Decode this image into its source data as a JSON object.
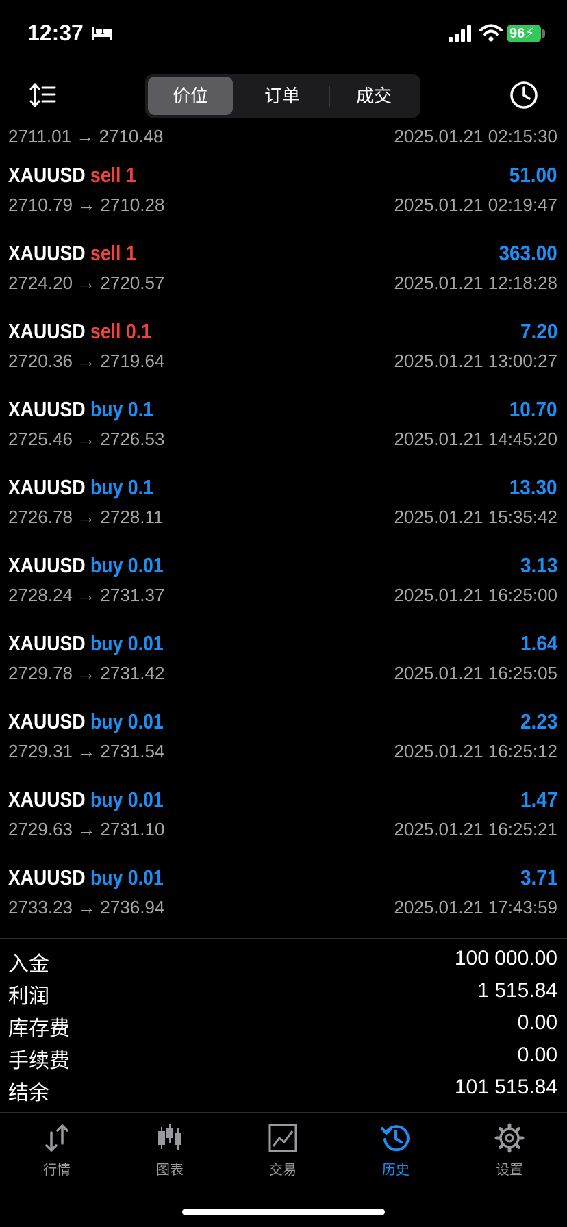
{
  "status_bar": {
    "time": "12:37",
    "battery": "96"
  },
  "toolbar": {
    "segments": [
      "价位",
      "订单",
      "成交"
    ],
    "active_segment": "价位"
  },
  "partial_row": {
    "prices": "2711.01 → 2710.48",
    "time": "2025.01.21 02:15:30"
  },
  "deals": [
    {
      "symbol": "XAUUSD",
      "side": "sell 1",
      "type": "sell",
      "amount": "51.00",
      "prices": "2710.79 → 2710.28",
      "time": "2025.01.21 02:19:47"
    },
    {
      "symbol": "XAUUSD",
      "side": "sell 1",
      "type": "sell",
      "amount": "363.00",
      "prices": "2724.20 → 2720.57",
      "time": "2025.01.21 12:18:28"
    },
    {
      "symbol": "XAUUSD",
      "side": "sell 0.1",
      "type": "sell",
      "amount": "7.20",
      "prices": "2720.36 → 2719.64",
      "time": "2025.01.21 13:00:27"
    },
    {
      "symbol": "XAUUSD",
      "side": "buy 0.1",
      "type": "buy",
      "amount": "10.70",
      "prices": "2725.46 → 2726.53",
      "time": "2025.01.21 14:45:20"
    },
    {
      "symbol": "XAUUSD",
      "side": "buy 0.1",
      "type": "buy",
      "amount": "13.30",
      "prices": "2726.78 → 2728.11",
      "time": "2025.01.21 15:35:42"
    },
    {
      "symbol": "XAUUSD",
      "side": "buy 0.01",
      "type": "buy",
      "amount": "3.13",
      "prices": "2728.24 → 2731.37",
      "time": "2025.01.21 16:25:00"
    },
    {
      "symbol": "XAUUSD",
      "side": "buy 0.01",
      "type": "buy",
      "amount": "1.64",
      "prices": "2729.78 → 2731.42",
      "time": "2025.01.21 16:25:05"
    },
    {
      "symbol": "XAUUSD",
      "side": "buy 0.01",
      "type": "buy",
      "amount": "2.23",
      "prices": "2729.31 → 2731.54",
      "time": "2025.01.21 16:25:12"
    },
    {
      "symbol": "XAUUSD",
      "side": "buy 0.01",
      "type": "buy",
      "amount": "1.47",
      "prices": "2729.63 → 2731.10",
      "time": "2025.01.21 16:25:21"
    },
    {
      "symbol": "XAUUSD",
      "side": "buy 0.01",
      "type": "buy",
      "amount": "3.71",
      "prices": "2733.23 → 2736.94",
      "time": "2025.01.21 17:43:59"
    }
  ],
  "summary": [
    {
      "label": "入金",
      "value": "100 000.00"
    },
    {
      "label": "利润",
      "value": "1 515.84"
    },
    {
      "label": "库存费",
      "value": "0.00"
    },
    {
      "label": "手续费",
      "value": "0.00"
    },
    {
      "label": "结余",
      "value": "101 515.84"
    }
  ],
  "tabs": [
    {
      "label": "行情",
      "icon": "quotes-arrows-icon"
    },
    {
      "label": "图表",
      "icon": "candlestick-chart-icon"
    },
    {
      "label": "交易",
      "icon": "trade-chart-icon"
    },
    {
      "label": "历史",
      "icon": "history-clock-icon"
    },
    {
      "label": "设置",
      "icon": "settings-gear-icon"
    }
  ],
  "active_tab": "历史",
  "colors": {
    "buy": "#1e8ef5",
    "sell": "#f0443a",
    "accent": "#1e8ef5",
    "background": "#000000"
  }
}
